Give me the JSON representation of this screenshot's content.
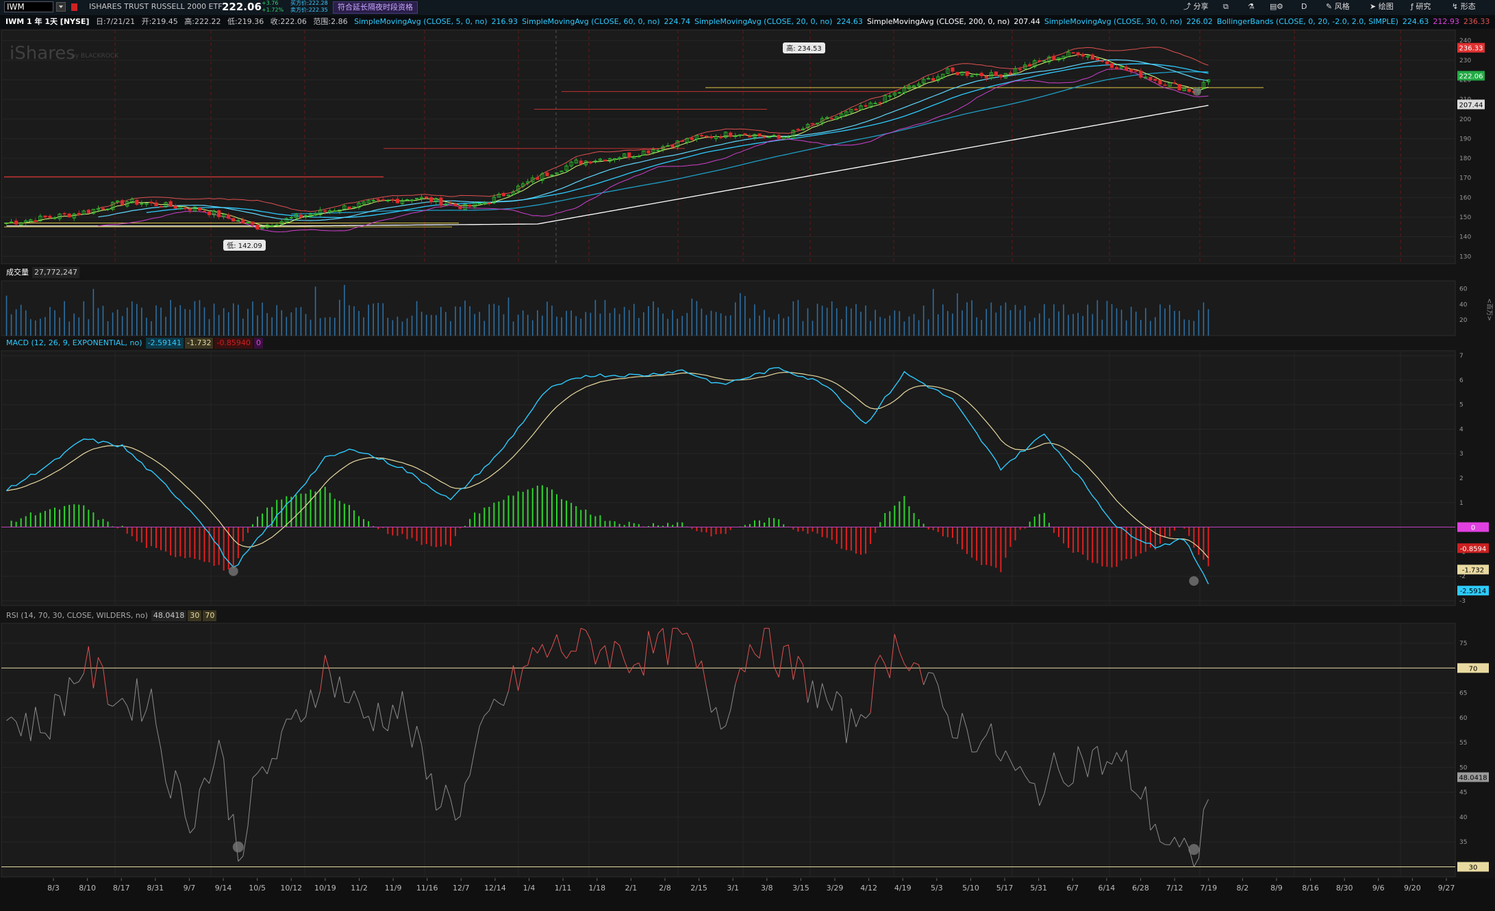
{
  "toolbar": {
    "symbol": "IWM",
    "security_name": "ISHARES TRUST RUSSELL 2000 ETF",
    "last_price": "222.06",
    "change": "+3.76",
    "change_pct": "+1.72%",
    "bid": "买方价:222.28",
    "ask": "卖方价:222.35",
    "extended_hours_label": "符合延长隔夜时段资格",
    "buttons": [
      "分享",
      "D",
      "风格",
      "绘图",
      "研究",
      "形态"
    ]
  },
  "info": {
    "title": "IWM 1 年 1天 [NYSE]",
    "date": "日:7/21/21",
    "open": "开:219.45",
    "high": "高:222.22",
    "low": "低:219.36",
    "close": "收:222.06",
    "range": "范围:2.86",
    "studies": [
      {
        "name": "SimpleMovingAvg (CLOSE, 5, 0, no)",
        "value": "216.93",
        "color": "#2ecbff"
      },
      {
        "name": "SimpleMovingAvg (CLOSE, 60, 0, no)",
        "value": "224.74",
        "color": "#2ecbff"
      },
      {
        "name": "SimpleMovingAvg (CLOSE, 20, 0, no)",
        "value": "224.63",
        "color": "#2ecbff"
      },
      {
        "name": "SimpleMovingAvg (CLOSE, 200, 0, no)",
        "value": "207.44",
        "color": "#ffffff"
      },
      {
        "name": "SimpleMovingAvg (CLOSE, 30, 0, no)",
        "value": "226.02",
        "color": "#2ecbff"
      },
      {
        "name": "BollingerBands (CLOSE, 0, 20, -2.0, 2.0, SIMPLE)",
        "value": "224.63",
        "color": "#2ecbff"
      }
    ],
    "bb_lower": "212.93",
    "bb_upper": "236.33"
  },
  "price_pane": {
    "high_label": "高: 234.53",
    "low_label": "低: 142.09",
    "watermark": "iShares",
    "watermark_sub": "by BLACKROCK",
    "y_ticks": [
      "240",
      "230",
      "220",
      "210",
      "200",
      "190",
      "180",
      "170",
      "160",
      "150",
      "140",
      "130"
    ],
    "badges": [
      {
        "text": "236.33",
        "color": "#e03030",
        "value": 236.33
      },
      {
        "text": "222.06",
        "color": "#22aa44",
        "value": 222.06
      },
      {
        "text": "207.44",
        "color": "#dddddd",
        "value": 207.44
      }
    ]
  },
  "volume_pane": {
    "label": "成交量",
    "value": "27,772,247",
    "y_ticks": [
      "60",
      "40",
      "20"
    ],
    "unit": "<百万>"
  },
  "macd_pane": {
    "label": "MACD (12, 26, 9, EXPONENTIAL, no)",
    "value": "-2.59141",
    "avg": "-1.732",
    "diff": "-0.85940",
    "zero": "0",
    "y_ticks": [
      "7",
      "6",
      "5",
      "4",
      "3",
      "2",
      "1",
      "0",
      "-1",
      "-2",
      "-3"
    ],
    "badges": [
      {
        "text": "0",
        "color": "#e040e0",
        "value": 0
      },
      {
        "text": "-0.8594",
        "color": "#cc2020",
        "value": -0.8594
      },
      {
        "text": "-1.732",
        "color": "#e8d9a0",
        "value": -1.732
      },
      {
        "text": "-2.5914",
        "color": "#2ecbff",
        "value": -2.5914
      }
    ]
  },
  "rsi_pane": {
    "label": "RSI (14, 70, 30, CLOSE, WILDERS, no)",
    "value": "48.0418",
    "ob": "30",
    "os": "70",
    "y_ticks": [
      "75",
      "70",
      "65",
      "60",
      "55",
      "50",
      "45",
      "40",
      "35",
      "30"
    ],
    "badges": [
      {
        "text": "70",
        "color": "#e8d9a0",
        "value": 70
      },
      {
        "text": "48.0418",
        "color": "#9a9a9a",
        "value": 48.0418
      },
      {
        "text": "30",
        "color": "#e8d9a0",
        "value": 30
      }
    ]
  },
  "x_axis": {
    "labels": [
      "8/3",
      "8/10",
      "8/17",
      "8/31",
      "9/7",
      "9/14",
      "10/5",
      "10/12",
      "10/19",
      "11/2",
      "11/9",
      "11/16",
      "12/7",
      "12/14",
      "1/4",
      "1/11",
      "1/18",
      "2/1",
      "2/8",
      "2/15",
      "3/1",
      "3/8",
      "3/15",
      "3/29",
      "4/12",
      "4/19",
      "5/3",
      "5/10",
      "5/17",
      "5/31",
      "6/7",
      "6/14",
      "6/28",
      "7/12",
      "7/19",
      "8/2",
      "8/9",
      "8/16",
      "8/30",
      "9/6",
      "9/20",
      "9/27"
    ]
  },
  "colors": {
    "up": "#2ecc2e",
    "down": "#e02b2b",
    "macd": "#2ecbff",
    "signal": "#e8d9a0",
    "rsi": "#8c8c8c",
    "rsi_ob": "#e05050",
    "bb": "#e05050",
    "sma200": "#ffffff"
  }
}
